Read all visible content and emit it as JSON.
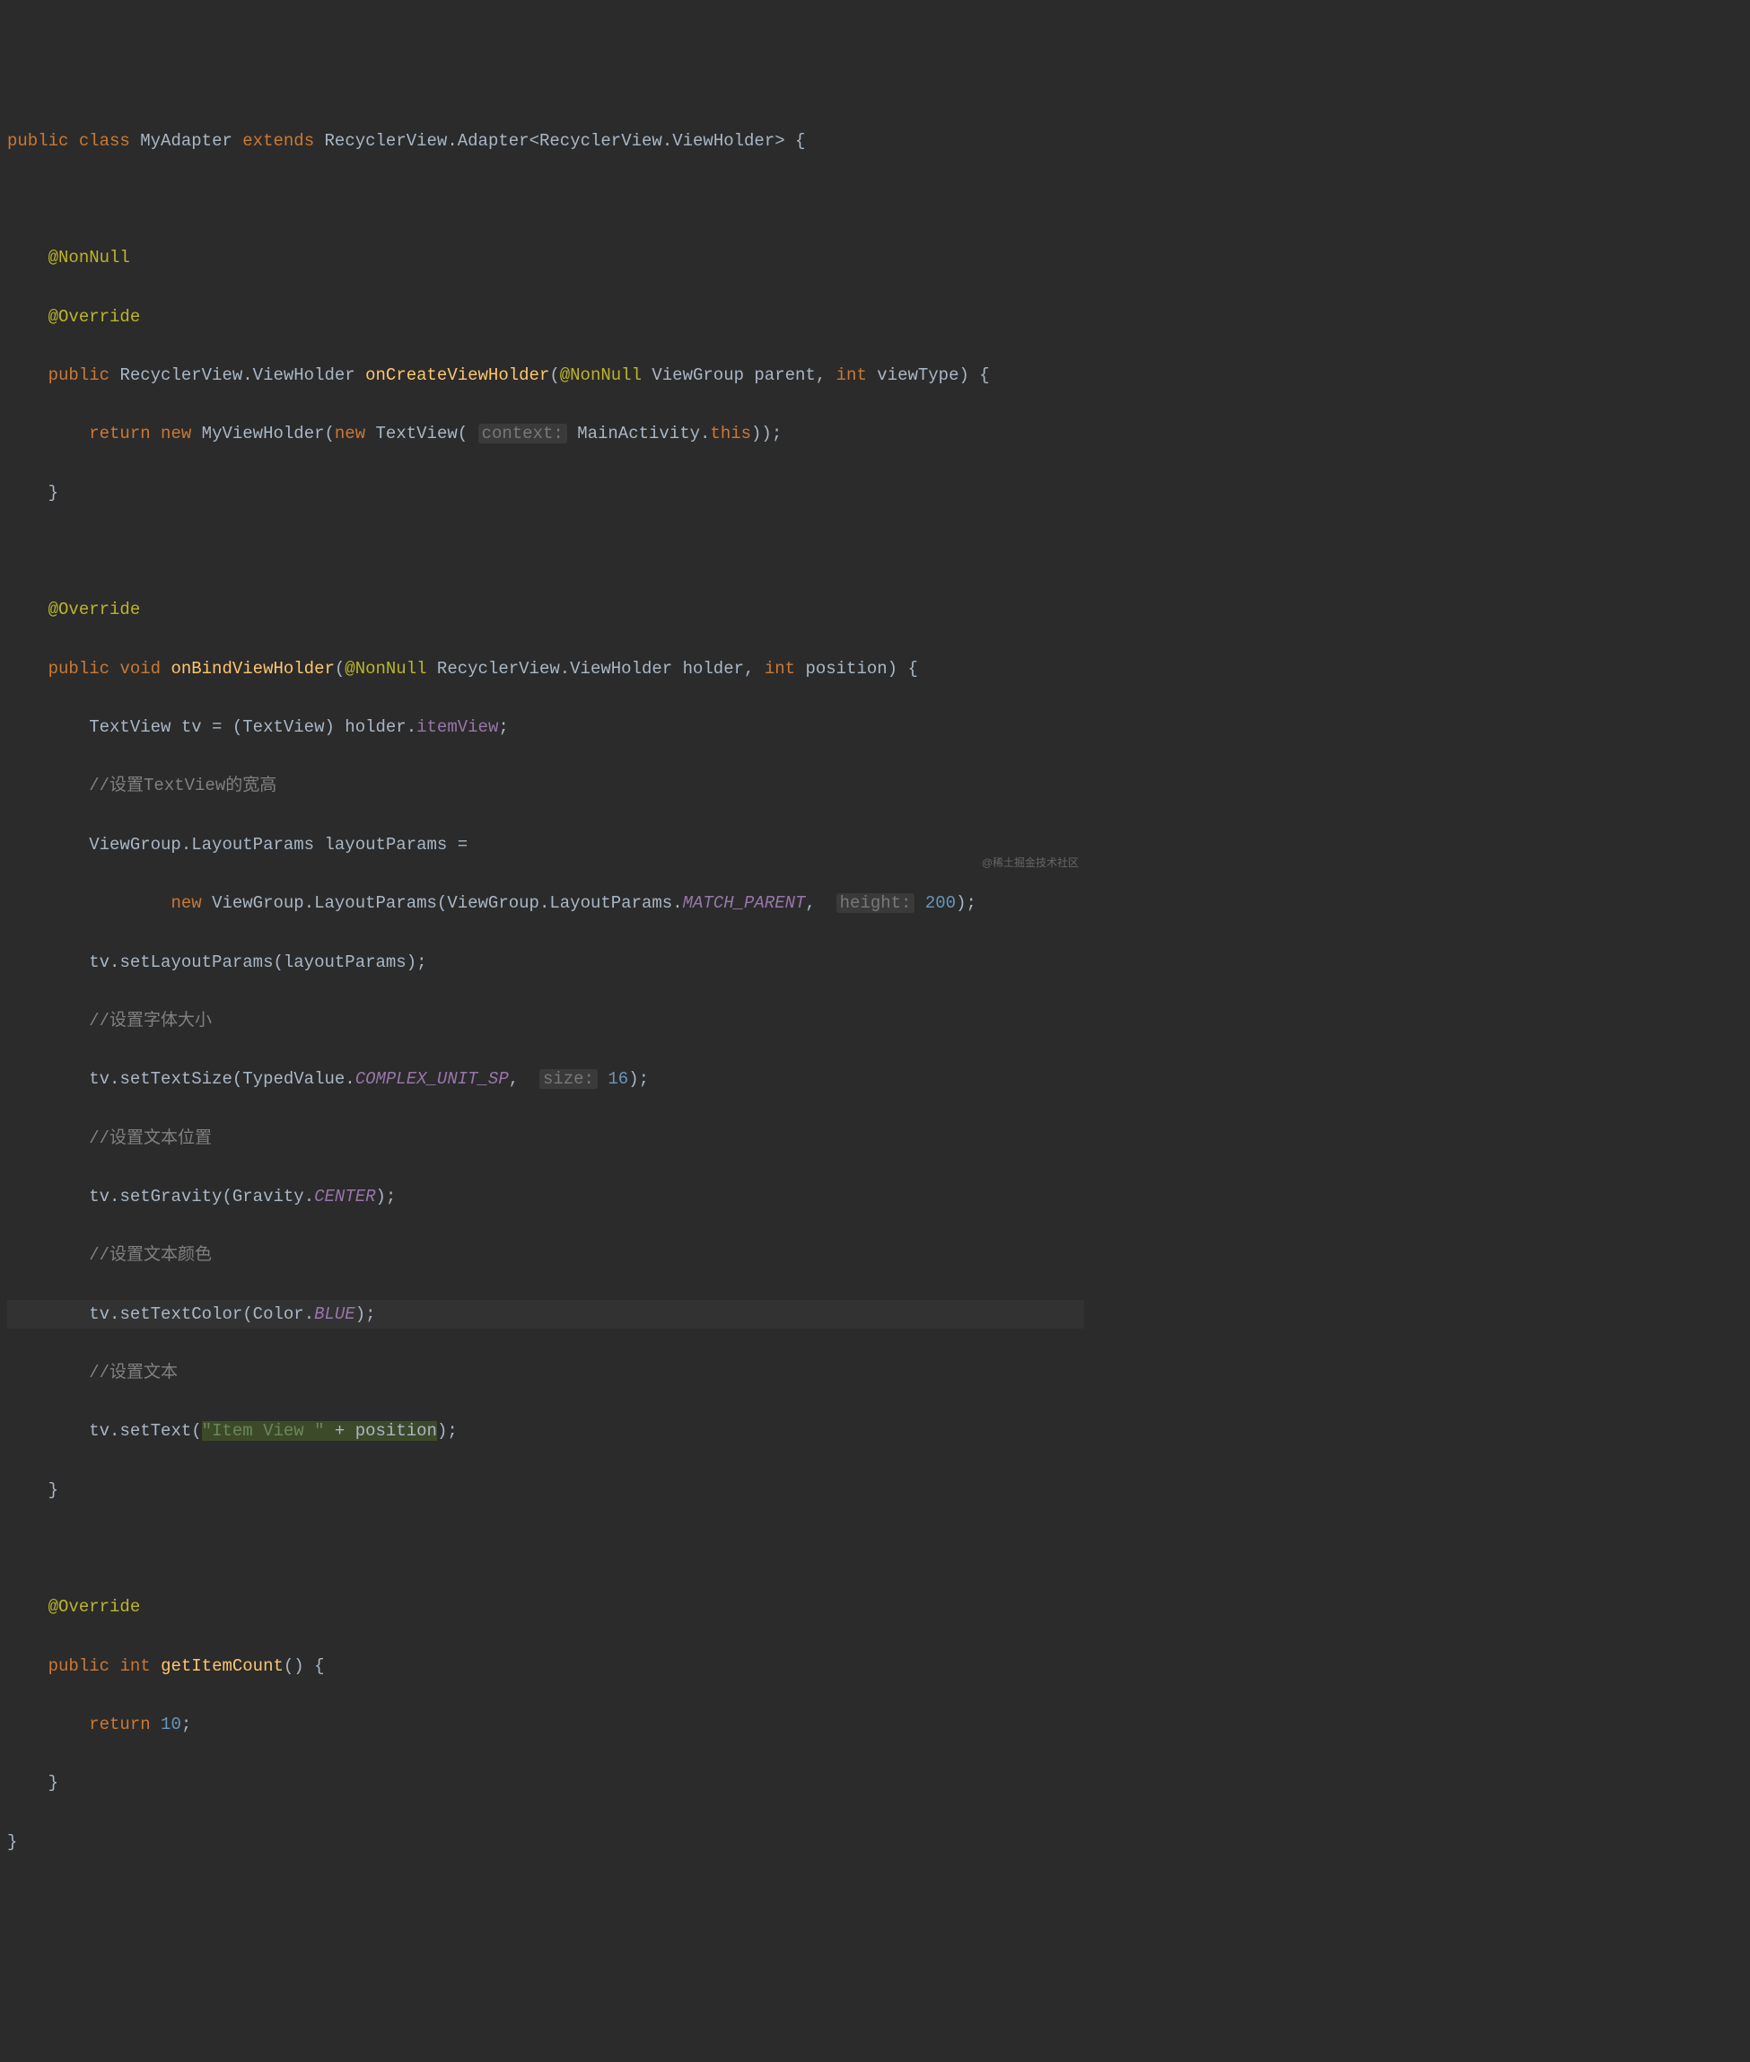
{
  "watermark": "@稀土掘金技术社区",
  "tokens": {
    "kw_public": "public",
    "kw_class": "class",
    "kw_extends": "extends",
    "kw_return": "return",
    "kw_new": "new",
    "kw_int": "int",
    "kw_void": "void",
    "kw_this": "this",
    "anno_nonnull": "@NonNull",
    "anno_override": "@Override",
    "class_MyAdapter": "MyAdapter",
    "class_RecyclerView": "RecyclerView",
    "class_Adapter": "Adapter",
    "class_ViewHolder": "ViewHolder",
    "class_ViewGroup": "ViewGroup",
    "class_MyViewHolder": "MyViewHolder",
    "class_TextView": "TextView",
    "class_MainActivity": "MainActivity",
    "class_LayoutParams": "LayoutParams",
    "class_TypedValue": "TypedValue",
    "class_Gravity": "Gravity",
    "class_Color": "Color",
    "method_onCreateViewHolder": "onCreateViewHolder",
    "method_onBindViewHolder": "onBindViewHolder",
    "method_getItemCount": "getItemCount",
    "method_setLayoutParams": "setLayoutParams",
    "method_setTextSize": "setTextSize",
    "method_setGravity": "setGravity",
    "method_setTextColor": "setTextColor",
    "method_setText": "setText",
    "param_parent": "parent",
    "param_viewType": "viewType",
    "param_holder": "holder",
    "param_position": "position",
    "var_tv": "tv",
    "var_layoutParams": "layoutParams",
    "field_itemView": "itemView",
    "const_MATCH_PARENT": "MATCH_PARENT",
    "const_COMPLEX_UNIT_SP": "COMPLEX_UNIT_SP",
    "const_CENTER": "CENTER",
    "const_BLUE": "BLUE",
    "hint_context": "context:",
    "hint_height": "height:",
    "hint_size": "size:",
    "num_200": "200",
    "num_16": "16",
    "num_10": "10",
    "str_itemview": "\"Item View \"",
    "comment_wh": "//设置TextView的宽高",
    "comment_fontsize": "//设置字体大小",
    "comment_textpos": "//设置文本位置",
    "comment_textcolor": "//设置文本颜色",
    "comment_text": "//设置文本"
  }
}
